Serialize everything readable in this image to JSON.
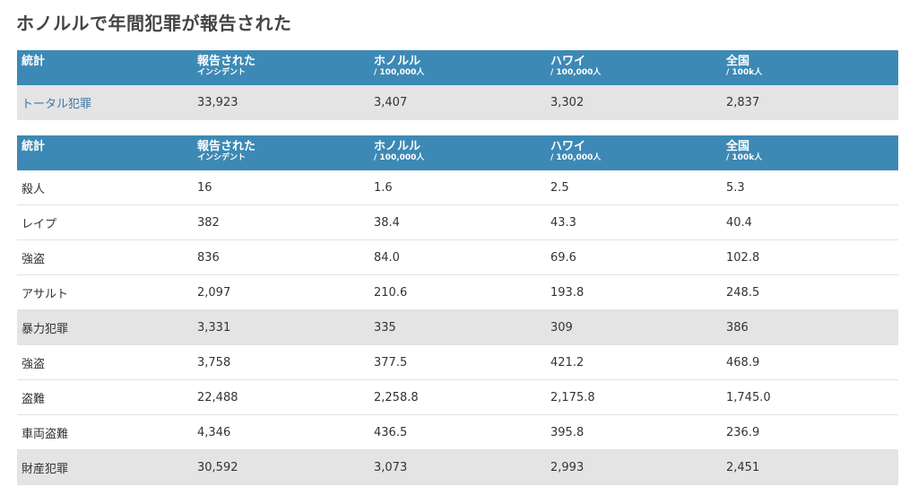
{
  "title": "ホノルルで年間犯罪が報告された",
  "headers": [
    {
      "label": "統計",
      "sub": ""
    },
    {
      "label": "報告された",
      "sub": "インシデント"
    },
    {
      "label": "ホノルル",
      "sub": "/ 100,000人"
    },
    {
      "label": "ハワイ",
      "sub": "/ 100,000人"
    },
    {
      "label": "全国",
      "sub": "/ 100k人"
    }
  ],
  "table1": {
    "rows": [
      {
        "stat": "トータル犯罪",
        "incidents": "33,923",
        "honolulu": "3,407",
        "hawaii": "3,302",
        "national": "2,837"
      }
    ]
  },
  "table2": {
    "rows": [
      {
        "stat": "殺人",
        "incidents": "16",
        "honolulu": "1.6",
        "hawaii": "2.5",
        "national": "5.3"
      },
      {
        "stat": "レイプ",
        "incidents": "382",
        "honolulu": "38.4",
        "hawaii": "43.3",
        "national": "40.4"
      },
      {
        "stat": "強盗",
        "incidents": "836",
        "honolulu": "84.0",
        "hawaii": "69.6",
        "national": "102.8"
      },
      {
        "stat": "アサルト",
        "incidents": "2,097",
        "honolulu": "210.6",
        "hawaii": "193.8",
        "national": "248.5"
      },
      {
        "stat": "暴力犯罪",
        "incidents": "3,331",
        "honolulu": "335",
        "hawaii": "309",
        "national": "386"
      },
      {
        "stat": "強盗",
        "incidents": "3,758",
        "honolulu": "377.5",
        "hawaii": "421.2",
        "national": "468.9"
      },
      {
        "stat": "盗難",
        "incidents": "22,488",
        "honolulu": "2,258.8",
        "hawaii": "2,175.8",
        "national": "1,745.0"
      },
      {
        "stat": "車両盗難",
        "incidents": "4,346",
        "honolulu": "436.5",
        "hawaii": "395.8",
        "national": "236.9"
      },
      {
        "stat": "財産犯罪",
        "incidents": "30,592",
        "honolulu": "3,073",
        "hawaii": "2,993",
        "national": "2,451"
      }
    ]
  },
  "colors": {
    "header_bg": "#3d89b5",
    "shade_bg": "#e4e4e4",
    "link": "#3d78a8"
  }
}
